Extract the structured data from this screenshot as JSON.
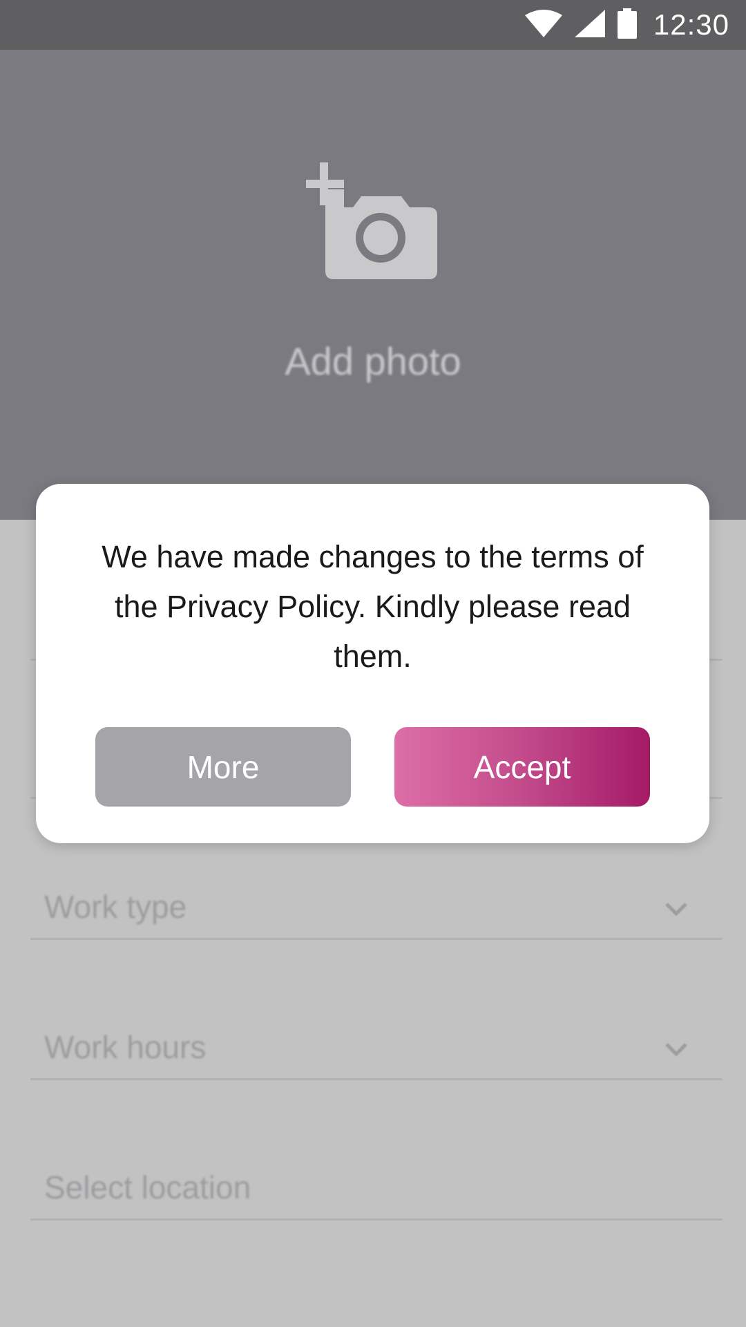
{
  "status_bar": {
    "time": "12:30",
    "icons": [
      "wifi-icon",
      "cell-signal-icon",
      "battery-icon"
    ]
  },
  "header": {
    "add_photo_label": "Add photo",
    "icon": "add-photo-camera-icon"
  },
  "form": {
    "fields": [
      {
        "label": "Work type",
        "has_dropdown": true
      },
      {
        "label": "Work hours",
        "has_dropdown": true
      },
      {
        "label": "Select location",
        "has_dropdown": false
      }
    ]
  },
  "dialog": {
    "message": "We have made changes to the terms of the Privacy Policy. Kindly please read them.",
    "more_label": "More",
    "accept_label": "Accept"
  },
  "colors": {
    "status_bar": "#5f5f62",
    "header_bg": "#7b7a80",
    "screen_bg": "#c2c2c3",
    "more_button": "#a4a4a9",
    "accept_gradient_start": "#dd6ea6",
    "accept_gradient_end": "#a51a66"
  }
}
